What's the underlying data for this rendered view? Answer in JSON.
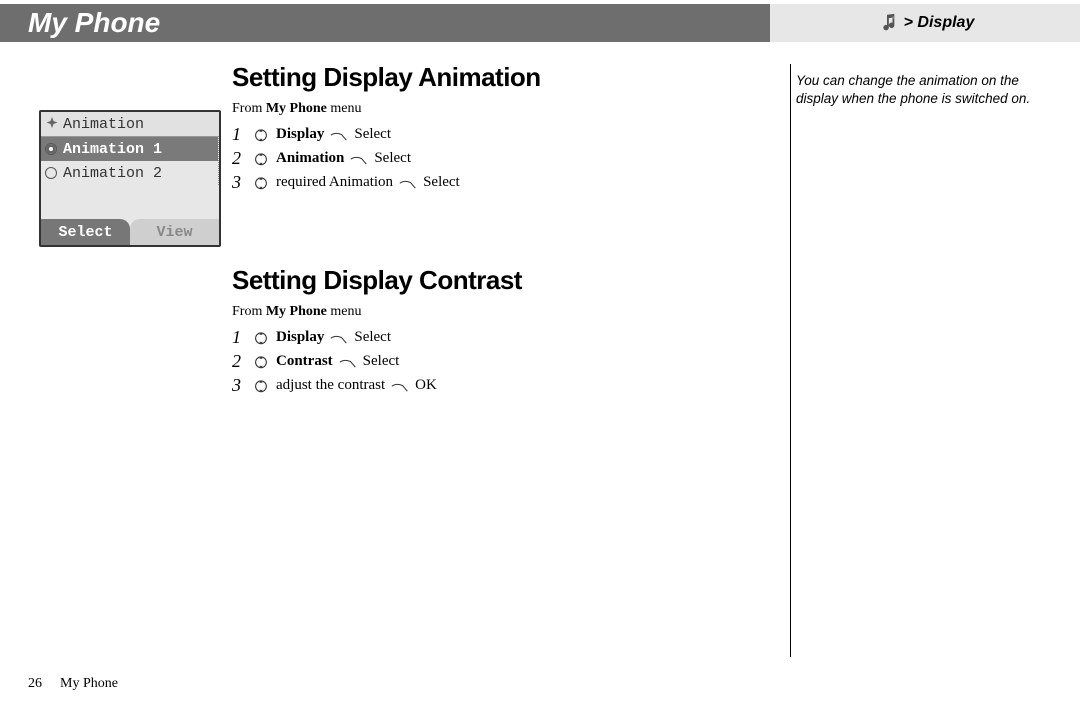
{
  "header": {
    "title": "My Phone"
  },
  "breadcrumb": {
    "label": "> Display"
  },
  "sections": [
    {
      "heading": "Setting Display Animation",
      "intro_prefix": "From ",
      "intro_bold": "My Phone",
      "intro_suffix": " menu",
      "steps": [
        {
          "num": "1",
          "item": "Display",
          "item_bold": true,
          "action": "Select"
        },
        {
          "num": "2",
          "item": "Animation",
          "item_bold": true,
          "action": "Select"
        },
        {
          "num": "3",
          "item": "required Animation",
          "item_bold": false,
          "action": "Select"
        }
      ]
    },
    {
      "heading": "Setting Display Contrast",
      "intro_prefix": "From ",
      "intro_bold": "My Phone",
      "intro_suffix": " menu",
      "steps": [
        {
          "num": "1",
          "item": "Display",
          "item_bold": true,
          "action": "Select"
        },
        {
          "num": "2",
          "item": "Contrast",
          "item_bold": true,
          "action": "Select"
        },
        {
          "num": "3",
          "item": "adjust the contrast",
          "item_bold": false,
          "action": "OK"
        }
      ]
    }
  ],
  "phone": {
    "title": "Animation",
    "items": [
      "Animation 1",
      "Animation 2"
    ],
    "selected_index": 0,
    "softkeys": {
      "left": "Select",
      "right": "View"
    }
  },
  "note": "You can change the animation on the display when the phone is switched on.",
  "footer": {
    "page": "26",
    "title": "My Phone"
  }
}
